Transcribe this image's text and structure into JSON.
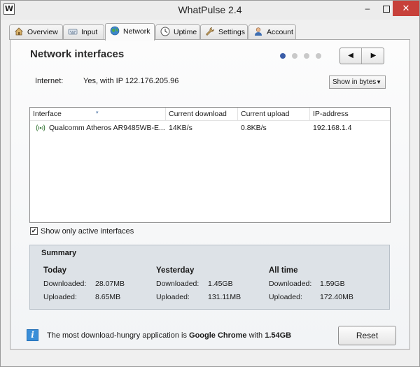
{
  "window": {
    "icon_letter": "W",
    "title": "WhatPulse 2.4",
    "minimize": "–",
    "close": "✕"
  },
  "tabs": [
    {
      "label": "Overview",
      "icon": "home-icon"
    },
    {
      "label": "Input",
      "icon": "keyboard-icon"
    },
    {
      "label": "Network",
      "icon": "globe-icon",
      "active": true
    },
    {
      "label": "Uptime",
      "icon": "clock-icon"
    },
    {
      "label": "Settings",
      "icon": "wrench-icon"
    },
    {
      "label": "Account",
      "icon": "user-icon"
    }
  ],
  "page": {
    "heading": "Network interfaces",
    "pager_active": 1,
    "pager_count": 4,
    "prev": "◀",
    "next": "▶"
  },
  "internet": {
    "label": "Internet:",
    "value": "Yes, with IP 122.176.205.96"
  },
  "unit_select": {
    "value": "Show in bytes",
    "arrow": "▼"
  },
  "table": {
    "columns": [
      "Interface",
      "Current download",
      "Current upload",
      "IP-address"
    ],
    "rows": [
      {
        "interface": "Qualcomm Atheros AR9485WB-E...",
        "download": "14KB/s",
        "upload": "0.8KB/s",
        "ip": "192.168.1.4"
      }
    ]
  },
  "filter": {
    "label": "Show only active interfaces",
    "checked": "✔"
  },
  "summary": {
    "title": "Summary",
    "downloaded_label": "Downloaded:",
    "uploaded_label": "Uploaded:",
    "periods": [
      {
        "title": "Today",
        "downloaded": "28.07MB",
        "uploaded": "8.65MB"
      },
      {
        "title": "Yesterday",
        "downloaded": "1.45GB",
        "uploaded": "131.11MB"
      },
      {
        "title": "All time",
        "downloaded": "1.59GB",
        "uploaded": "172.40MB"
      }
    ]
  },
  "footer": {
    "icon": "info-icon",
    "text_prefix": "The most download-hungry application is ",
    "app": "Google Chrome",
    "text_mid": " with ",
    "amount": "1.54GB",
    "reset": "Reset"
  },
  "colors": {
    "close_button": "#c7403a",
    "active_dot": "#3a5da8",
    "info_icon": "#3a8ed8"
  }
}
